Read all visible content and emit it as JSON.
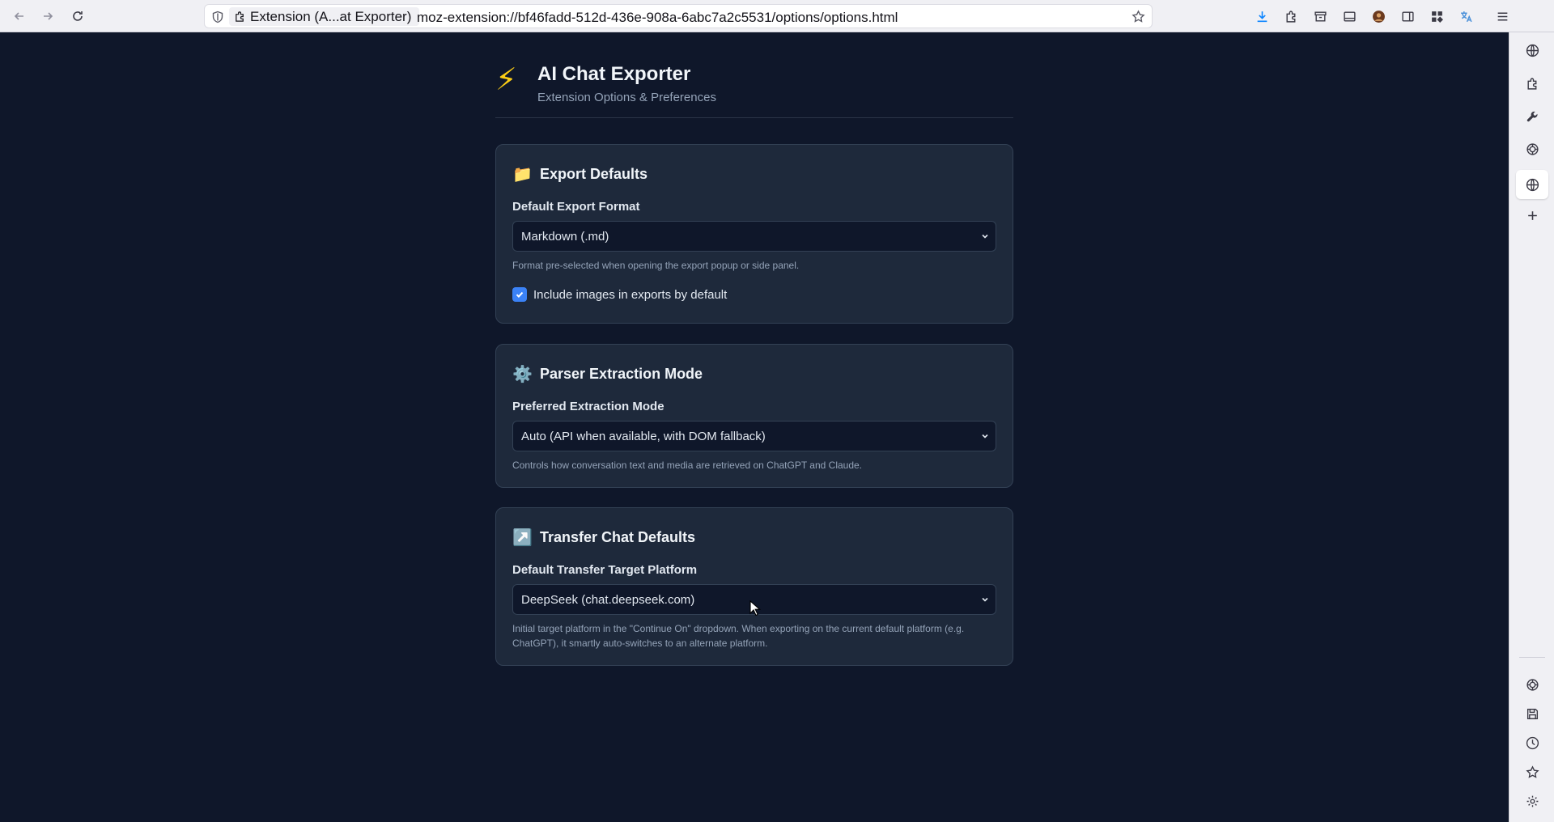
{
  "browser": {
    "tab_identity": "Extension (A...at Exporter)",
    "url": "moz-extension://bf46fadd-512d-436e-908a-6abc7a2c5531/options/options.html"
  },
  "header": {
    "logo_icon": "⚡",
    "title": "AI Chat Exporter",
    "subtitle": "Extension Options & Preferences"
  },
  "sections": {
    "export": {
      "icon": "📁",
      "title": "Export Defaults",
      "format_label": "Default Export Format",
      "format_value": "Markdown (.md)",
      "format_hint": "Format pre-selected when opening the export popup or side panel.",
      "images_label": "Include images in exports by default",
      "images_checked": true
    },
    "parser": {
      "icon": "⚙️",
      "title": "Parser Extraction Mode",
      "mode_label": "Preferred Extraction Mode",
      "mode_value": "Auto (API when available, with DOM fallback)",
      "mode_hint": "Controls how conversation text and media are retrieved on ChatGPT and Claude."
    },
    "transfer": {
      "icon": "↗️",
      "title": "Transfer Chat Defaults",
      "target_label": "Default Transfer Target Platform",
      "target_value": "DeepSeek (chat.deepseek.com)",
      "target_hint": "Initial target platform in the \"Continue On\" dropdown. When exporting on the current default platform (e.g. ChatGPT), it smartly auto-switches to an alternate platform."
    }
  },
  "colors": {
    "background": "#0f172a",
    "card": "#1e293b",
    "accent": "#3b82f6",
    "logo": "#facc15"
  }
}
